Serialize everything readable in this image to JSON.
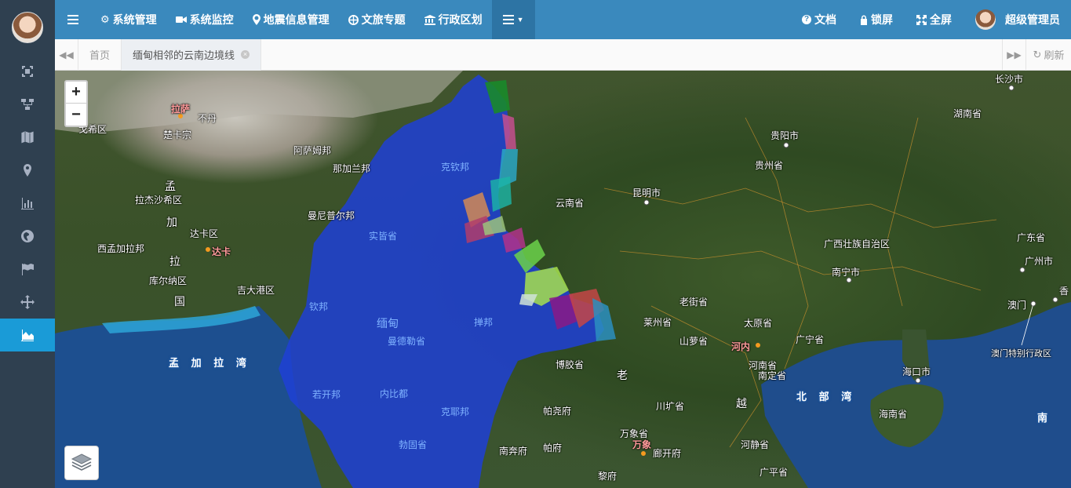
{
  "nav": {
    "items": [
      {
        "icon": "gear-icon",
        "label": "系统管理"
      },
      {
        "icon": "video-icon",
        "label": "系统监控"
      },
      {
        "icon": "map-marker-icon",
        "label": "地震信息管理"
      },
      {
        "icon": "globe-icon",
        "label": "文旅专题"
      },
      {
        "icon": "bank-icon",
        "label": "行政区划"
      }
    ],
    "right": {
      "docs": "文档",
      "lock": "锁屏",
      "fullscreen": "全屏",
      "user": "超级管理员"
    }
  },
  "tabs": {
    "home": "首页",
    "active": "缅甸相邻的云南边境线",
    "refresh": "刷新"
  },
  "sidebar": {
    "items": [
      "frame-icon",
      "diagram-icon",
      "map-icon",
      "map-marker-icon",
      "bar-chart-icon",
      "globe-icon",
      "flag-icon",
      "move-icon",
      "area-chart-icon"
    ],
    "active_index": 8
  },
  "map": {
    "zoom_in": "+",
    "zoom_out": "−",
    "labels": {
      "changsha": "长沙市",
      "hunan": "湖南省",
      "guiyang": "贵阳市",
      "guizhou": "贵州省",
      "kunming": "昆明市",
      "yunnan": "云南省",
      "guangxi": "广西壮族自治区",
      "nanning": "南宁市",
      "guangdong": "广东省",
      "guangzhou": "广州市",
      "macau": "澳门",
      "macau_sar": "澳门特别行政区",
      "xiang": "香",
      "haikou": "海口市",
      "hainan": "海南省",
      "beibu": "北 部 湾",
      "nan": "南",
      "laos_north": "老街省",
      "taiyuan": "太原省",
      "guangning": "广宁省",
      "hanoi": "河内",
      "hanam": "河南省",
      "nanding": "南定省",
      "hejing": "河静省",
      "guangping": "广平省",
      "yue": "越",
      "laijian": "老街省",
      "bianjiang": "莱州省",
      "shanfu": "山萝省",
      "wanxiang_prov": "万象省",
      "wanxiang": "万象",
      "langkaifu": "廊开府",
      "chuankuang": "川圹省",
      "lao": "老",
      "bojiao": "博胶省",
      "phayao": "帕尧府",
      "phrae": "帕府",
      "nan_prov": "南奔府",
      "loei": "黎府",
      "bangladesh_bay": "孟 加 拉 湾",
      "kachin": "克钦邦",
      "sagaing": "实皆省",
      "chin": "钦邦",
      "myanmar": "缅甸",
      "mandalay": "曼德勒省",
      "shan": "掸邦",
      "naypyidaw": "内比都",
      "rakhine": "若开邦",
      "kayin": "克耶邦",
      "bago": "勃固省",
      "lhasa": "拉萨",
      "bhutan": "不丹",
      "xixi": "戈希区",
      "chakazong": "楚卡宗",
      "assam": "阿萨姆邦",
      "nagaland": "那加兰邦",
      "manipur": "曼尼普尔邦",
      "meng": "孟",
      "jia": "加",
      "la": "拉",
      "guo": "国",
      "rajshahi": "拉杰沙希区",
      "dhaka_div": "达卡区",
      "dhaka": "达卡",
      "west_bengal": "西孟加拉邦",
      "khulna": "库尔纳区",
      "chittagong": "吉大港区"
    }
  },
  "colors": {
    "nav_bg": "#3a89bd",
    "sidebar_bg": "#2f4050",
    "sidebar_active": "#1a9bd7",
    "myanmar_fill": "#1f3fd6"
  }
}
